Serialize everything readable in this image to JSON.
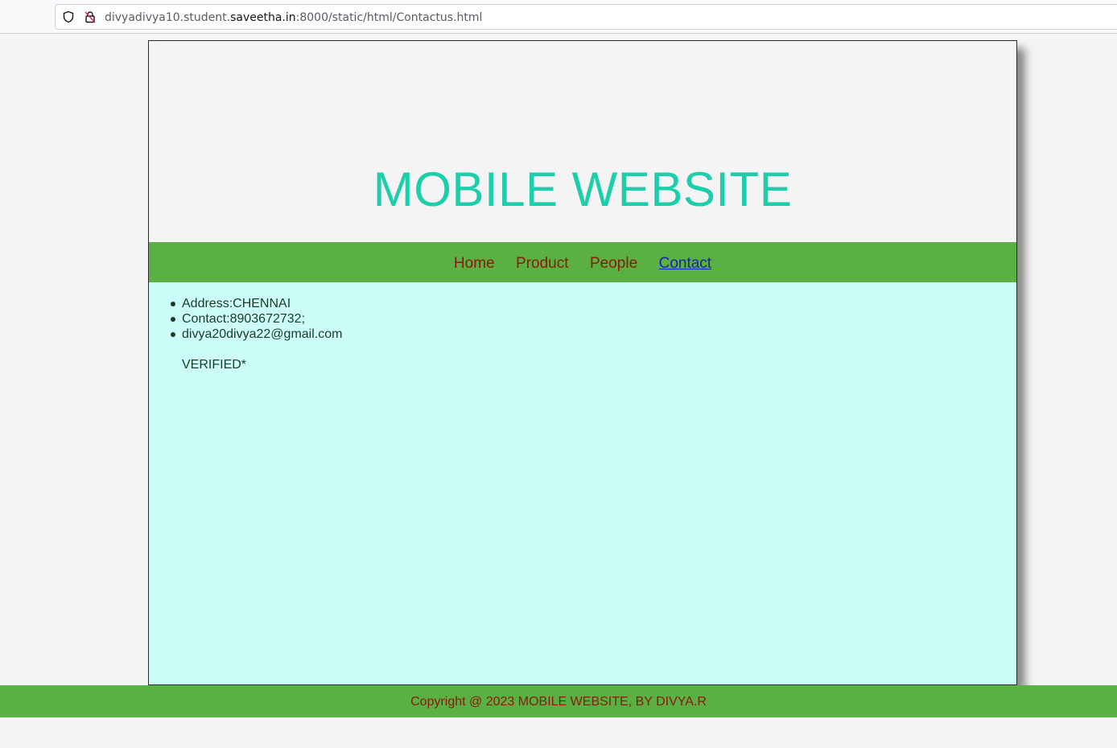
{
  "browser": {
    "url_prefix": "divyadivya10.student.",
    "url_domain": "saveetha.in",
    "url_suffix": ":8000/static/html/Contactus.html",
    "icons": [
      "shield-icon",
      "insecure-lock-icon"
    ]
  },
  "header": {
    "title": "MOBILE WEBSITE"
  },
  "nav": {
    "items": [
      {
        "label": "Home"
      },
      {
        "label": "Product"
      },
      {
        "label": "People"
      },
      {
        "label": "Contact"
      }
    ],
    "active": "Contact"
  },
  "content": {
    "items": [
      "Address:CHENNAI",
      "Contact:8903672732;",
      "divya20divya22@gmail.com"
    ],
    "verified": "VERIFIED*"
  },
  "footer": {
    "text": "Copyright @ 2023 MOBILE WEBSITE, BY DIVYA.R"
  },
  "colors": {
    "title": "#1ccfaa",
    "nav_bg": "#5ab043",
    "nav_link": "#8b1a0a",
    "nav_active": "#1a22b0",
    "content_bg": "#ccfef9",
    "page_bg": "#f4f4f4"
  }
}
